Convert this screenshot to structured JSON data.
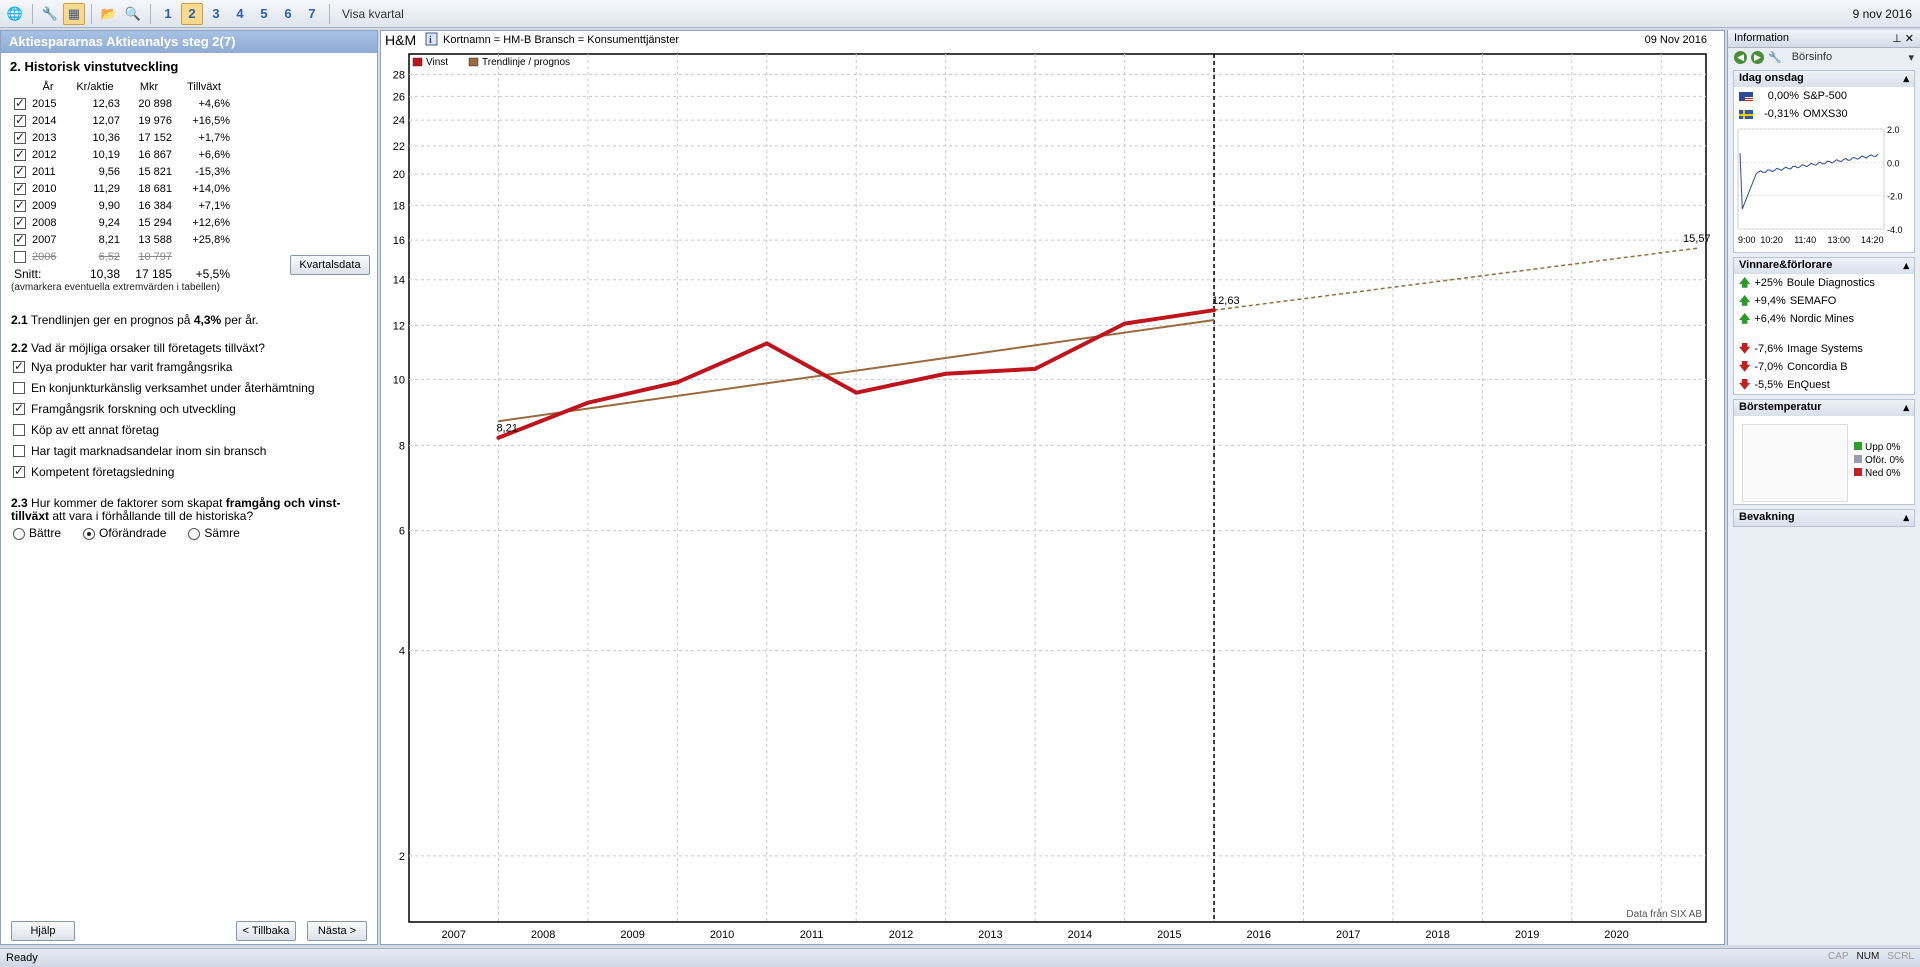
{
  "toolbar": {
    "steps": [
      "1",
      "2",
      "3",
      "4",
      "5",
      "6",
      "7"
    ],
    "visa_kvartal": "Visa kvartal",
    "date": "9 nov 2016"
  },
  "left": {
    "title": "Aktiespararnas Aktieanalys steg 2(7)",
    "heading": "2. Historisk vinstutveckling",
    "table_headers": [
      "År",
      "Kr/aktie",
      "Mkr",
      "Tillväxt"
    ],
    "rows": [
      {
        "year": "2015",
        "kr": "12,63",
        "mkr": "20 898",
        "growth": "+4,6%",
        "checked": true
      },
      {
        "year": "2014",
        "kr": "12,07",
        "mkr": "19 976",
        "growth": "+16,5%",
        "checked": true
      },
      {
        "year": "2013",
        "kr": "10,36",
        "mkr": "17 152",
        "growth": "+1,7%",
        "checked": true
      },
      {
        "year": "2012",
        "kr": "10,19",
        "mkr": "16 867",
        "growth": "+6,6%",
        "checked": true
      },
      {
        "year": "2011",
        "kr": "9,56",
        "mkr": "15 821",
        "growth": "-15,3%",
        "checked": true
      },
      {
        "year": "2010",
        "kr": "11,29",
        "mkr": "18 681",
        "growth": "+14,0%",
        "checked": true
      },
      {
        "year": "2009",
        "kr": "9,90",
        "mkr": "16 384",
        "growth": "+7,1%",
        "checked": true
      },
      {
        "year": "2008",
        "kr": "9,24",
        "mkr": "15 294",
        "growth": "+12,6%",
        "checked": true
      },
      {
        "year": "2007",
        "kr": "8,21",
        "mkr": "13 588",
        "growth": "+25,8%",
        "checked": true
      },
      {
        "year": "2006",
        "kr": "6,52",
        "mkr": "10 797",
        "growth": "",
        "checked": false
      }
    ],
    "kvartalsdata": "Kvartalsdata",
    "snitt_label": "Snitt:",
    "snitt_kr": "10,38",
    "snitt_mkr": "17 185",
    "snitt_growth": "+5,5%",
    "note": "(avmarkera eventuella extremvärden i tabellen)",
    "q21_num": "2.1",
    "q21_text": "Trendlinjen ger en prognos på",
    "q21_value": "4,3%",
    "q21_suffix": "per år.",
    "q22_num": "2.2",
    "q22_text": "Vad är möjliga orsaker till företagets tillväxt?",
    "reasons": [
      {
        "label": "Nya produkter har varit framgångsrika",
        "checked": true
      },
      {
        "label": "En konjunkturkänslig verksamhet under återhämtning",
        "checked": false
      },
      {
        "label": "Framgångsrik forskning och utveckling",
        "checked": true
      },
      {
        "label": "Köp av ett annat företag",
        "checked": false
      },
      {
        "label": "Har tagit marknadsandelar inom sin bransch",
        "checked": false
      },
      {
        "label": "Kompetent företagsledning",
        "checked": true
      }
    ],
    "q23_num": "2.3",
    "q23_text_a": "Hur kommer de faktorer som skapat",
    "q23_bold": "framgång och vinst-tillväxt",
    "q23_text_b": "att vara i förhållande till de historiska?",
    "radios": [
      {
        "label": "Bättre",
        "checked": false
      },
      {
        "label": "Oförändrade",
        "checked": true
      },
      {
        "label": "Sämre",
        "checked": false
      }
    ],
    "help": "Hjälp",
    "back": "< Tillbaka",
    "next": "Nästa >"
  },
  "chart_header": {
    "company": "H&M",
    "info": "Kortnamn = HM-B   Bransch = Konsumenttjänster",
    "date": "09 Nov 2016",
    "source": "Data från SIX AB"
  },
  "chart_data": {
    "type": "line",
    "yscale": "log",
    "ylim": [
      1.6,
      30
    ],
    "yticks": [
      2,
      4,
      6,
      8,
      10,
      12,
      14,
      16,
      18,
      20,
      22,
      24,
      26,
      28
    ],
    "categories": [
      "2007",
      "2008",
      "2009",
      "2010",
      "2011",
      "2012",
      "2013",
      "2014",
      "2015",
      "2016",
      "2017",
      "2018",
      "2019",
      "2020"
    ],
    "series": [
      {
        "name": "Vinst",
        "color": "#c0141c",
        "x": [
          2007.5,
          2008.5,
          2009.5,
          2010.5,
          2011.5,
          2012.5,
          2013.5,
          2014.5,
          2015.5
        ],
        "values": [
          8.21,
          9.24,
          9.9,
          11.29,
          9.56,
          10.19,
          10.36,
          12.07,
          12.63
        ]
      },
      {
        "name": "Trendlinje / prognos",
        "color": "#9b6a3c",
        "x": [
          2007.5,
          2015.5
        ],
        "values": [
          8.68,
          12.22
        ]
      }
    ],
    "forecast": {
      "x": [
        2015.5,
        2020.9
      ],
      "values": [
        12.63,
        15.57
      ]
    },
    "labels": [
      {
        "x": 2007.5,
        "value": 8.21,
        "text": "8,21"
      },
      {
        "x": 2015.5,
        "value": 12.63,
        "text": "12,63"
      },
      {
        "x": 2020.9,
        "value": 15.57,
        "text": "15,57"
      }
    ],
    "divider_x": 2015.5,
    "grid": true,
    "legend": "top-left"
  },
  "right": {
    "title": "Information",
    "borsinfo": "Börsinfo",
    "idag": "Idag onsdag",
    "indices": [
      {
        "change": "0,00%",
        "name": "S&P-500",
        "flag": "us"
      },
      {
        "change": "-0,31%",
        "name": "OMXS30",
        "flag": "se"
      }
    ],
    "mini_chart": {
      "xticks": [
        "9:00",
        "10:20",
        "11:40",
        "13:00",
        "14:20"
      ],
      "yticks": [
        "2.0",
        "0.0",
        "-2.0",
        "-4.0"
      ]
    },
    "vinnare_title": "Vinnare&förlorare",
    "winners": [
      {
        "change": "+25%",
        "name": "Boule Diagnostics"
      },
      {
        "change": "+9,4%",
        "name": "SEMAFO"
      },
      {
        "change": "+6,4%",
        "name": "Nordic Mines"
      }
    ],
    "losers": [
      {
        "change": "-7,6%",
        "name": "Image Systems"
      },
      {
        "change": "-7,0%",
        "name": "Concordia B"
      },
      {
        "change": "-5,5%",
        "name": "EnQuest"
      }
    ],
    "borstemp_title": "Börstemperatur",
    "temp": [
      {
        "label": "Upp 0%",
        "color": "#2aa02a"
      },
      {
        "label": "Oför. 0%",
        "color": "#9a9ab0"
      },
      {
        "label": "Ned 0%",
        "color": "#c42020"
      }
    ],
    "bevakning": "Bevakning"
  },
  "status": {
    "text": "Ready",
    "indicators": [
      "CAP",
      "NUM",
      "SCRL"
    ]
  }
}
